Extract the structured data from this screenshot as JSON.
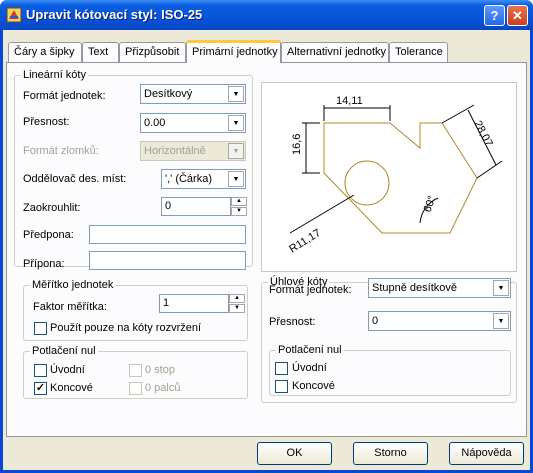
{
  "window": {
    "title": "Upravit kótovací styl: ISO-25",
    "help_label": "?",
    "close_label": "✕"
  },
  "tabs": [
    {
      "label": "Čáry a šipky"
    },
    {
      "label": "Text"
    },
    {
      "label": "Přizpůsobit"
    },
    {
      "label": "Primární jednotky",
      "selected": true
    },
    {
      "label": "Alternativní jednotky"
    },
    {
      "label": "Tolerance"
    }
  ],
  "linear": {
    "title": "Lineární kóty",
    "unit_format": {
      "label": "Formát jednotek:",
      "value": "Desítkový"
    },
    "precision": {
      "label": "Přesnost:",
      "value": "0.00"
    },
    "fraction_format": {
      "label": "Formát zlomků:",
      "value": "Horizontálně",
      "disabled": true
    },
    "decimal_separator": {
      "label": "Oddělovač des. míst:",
      "value": "',' (Čárka)"
    },
    "round_off": {
      "label": "Zaokrouhlit:",
      "value": "0"
    },
    "prefix": {
      "label": "Předpona:",
      "value": ""
    },
    "suffix": {
      "label": "Přípona:",
      "value": ""
    }
  },
  "scale": {
    "title": "Měřítko jednotek",
    "factor": {
      "label": "Faktor měřítka:",
      "value": "1"
    },
    "layout_only": {
      "label": "Použít pouze na kóty rozvržení",
      "checked": false
    }
  },
  "zero_linear": {
    "title": "Potlačení nul",
    "leading": {
      "label": "Úvodní",
      "checked": false
    },
    "trailing": {
      "label": "Koncové",
      "checked": true
    },
    "feet": {
      "label": "0 stop",
      "checked": false,
      "disabled": true
    },
    "inches": {
      "label": "0 palců",
      "checked": false,
      "disabled": true
    }
  },
  "preview": {
    "top_dim": "14,11",
    "left_dim": "16,6",
    "right_dim": "28,07",
    "angle_dim": "60°",
    "radius_dim": "R11,17"
  },
  "angular": {
    "title": "Úhlové kóty",
    "unit_format": {
      "label": "Formát jednotek:",
      "value": "Stupně desítkově"
    },
    "precision": {
      "label": "Přesnost:",
      "value": "0"
    }
  },
  "zero_angular": {
    "title": "Potlačení nul",
    "leading": {
      "label": "Úvodní",
      "checked": false
    },
    "trailing": {
      "label": "Koncové",
      "checked": false
    }
  },
  "buttons": {
    "ok": "OK",
    "cancel": "Storno",
    "help": "Nápověda"
  },
  "colors": {
    "titlebar": "#0853d9",
    "dialog_bg": "#ece9d8",
    "preview_geometry": "#b08a2a"
  }
}
